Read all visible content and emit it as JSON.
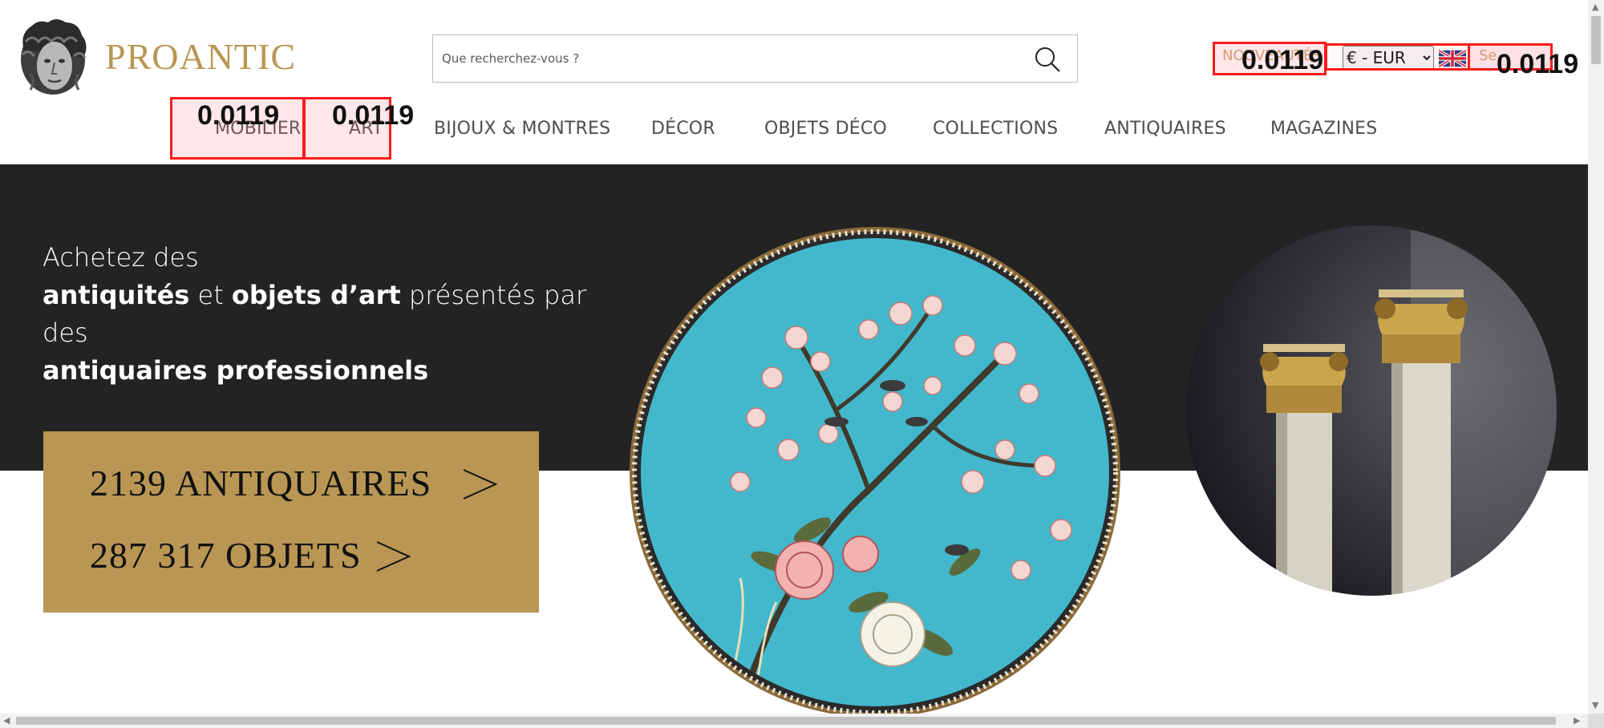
{
  "brand": {
    "name": "PROANTIC"
  },
  "search": {
    "placeholder": "Que recherchez-vous ?"
  },
  "top_links": {
    "nouveautes": "NOUVEAUTÉS",
    "currency": "€ - EUR",
    "signin": "Se"
  },
  "nav": {
    "items": [
      "MOBILIER",
      "ART",
      "BIJOUX & MONTRES",
      "DÉCOR",
      "OBJETS DÉCO",
      "COLLECTIONS",
      "ANTIQUAIRES",
      "MAGAZINES"
    ]
  },
  "hero": {
    "line1": "Achetez des",
    "line2_bold1": "antiquités",
    "line2_mid": " et ",
    "line2_bold2": "objets d’art",
    "line2_end": " présentés par des",
    "line3_bold": "antiquaires professionnels"
  },
  "cta": {
    "antiquaires": "2139 ANTIQUAIRES",
    "objets": "287 317 OBJETS"
  },
  "annotations": {
    "score_mobilier": "0.0119",
    "score_art": "0.0119",
    "score_nouveautes": "0.0119",
    "score_signin": "0.0119"
  },
  "colors": {
    "brand_gold": "#b99654",
    "hero_dark": "#232323",
    "annotation_red": "#ff1a1a"
  }
}
